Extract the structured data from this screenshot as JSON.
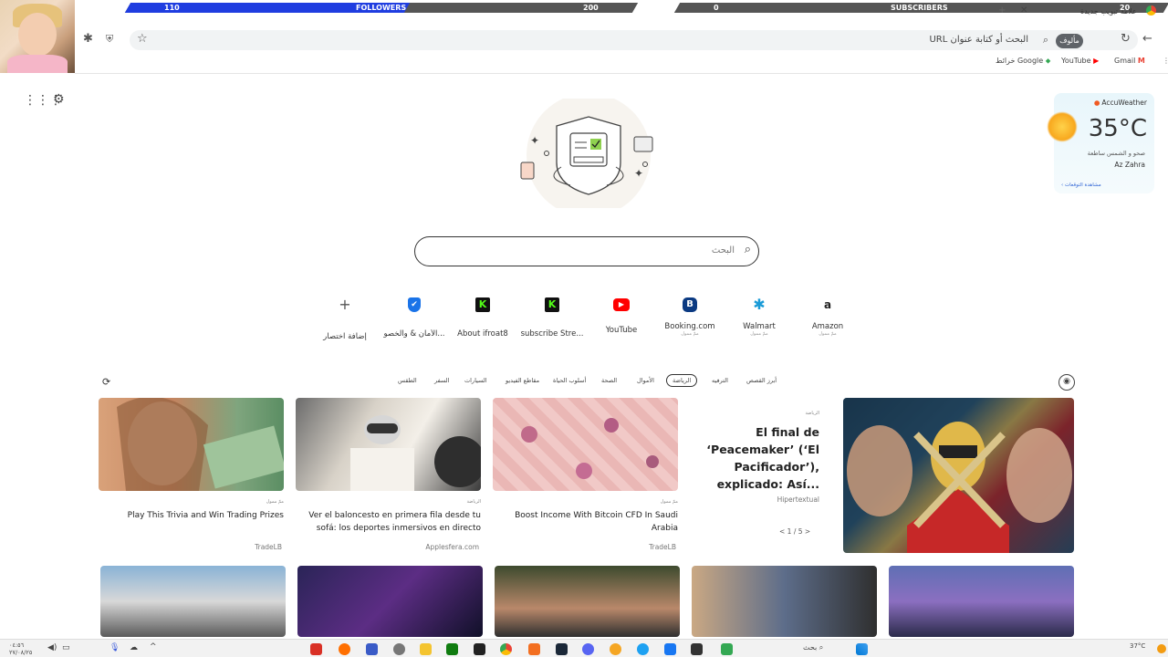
{
  "stream_overlay": {
    "followers_label": "FOLLOWERS",
    "followers_current": "110",
    "followers_goal": "200",
    "followers_progress": 0.55,
    "subscribers_label": "SUBSCRIBERS",
    "subscribers_current": "0",
    "subscribers_goal": "20"
  },
  "browser": {
    "tab_title": "علامة تبويب جديدة",
    "omnibox_placeholder": "البحث أو كتابة عنوان URL",
    "profile_label": "مألوف",
    "bookmarks": [
      {
        "label": "Gmail",
        "icon": "gmail-icon"
      },
      {
        "label": "YouTube",
        "icon": "youtube-icon"
      },
      {
        "label": "خرائط Google",
        "icon": "maps-icon"
      }
    ]
  },
  "newtab": {
    "search_placeholder": "البحث",
    "shortcuts": [
      {
        "label": "Amazon",
        "sub": "ممّ ممول",
        "letter": "a",
        "color": "#ffffff",
        "fg": "#222"
      },
      {
        "label": "Walmart",
        "sub": "ممّ ممول",
        "letter": "✱",
        "color": "#ffffff",
        "fg": "#1a9bd7"
      },
      {
        "label": "Booking.com",
        "sub": "ممّ ممول",
        "letter": "B",
        "color": "#0b3a82",
        "fg": "#ffffff"
      },
      {
        "label": "YouTube",
        "sub": "",
        "letter": "▶",
        "color": "#ff0000",
        "fg": "#ffffff"
      },
      {
        "label": "subscribe Stre...",
        "sub": "",
        "letter": "K",
        "color": "#111111",
        "fg": "#53fc18"
      },
      {
        "label": "About ifroat8",
        "sub": "",
        "letter": "K",
        "color": "#111111",
        "fg": "#53fc18"
      },
      {
        "label": "الأمان & والخصو...",
        "sub": "",
        "letter": "✔",
        "color": "#1a73e8",
        "fg": "#ffffff"
      },
      {
        "label": "إضافة اختصار",
        "sub": "",
        "letter": "+",
        "color": "#ffffff",
        "fg": "#555"
      }
    ],
    "weather": {
      "brand": "AccuWeather",
      "temp": "35°C",
      "condition": "صحو و الشمس ساطعة",
      "place": "Az Zahra",
      "link": "مشاهدة التوقعات"
    }
  },
  "feed": {
    "categories": [
      "أبرز القصص",
      "الترفيه",
      "الرياضة",
      "الأموال",
      "الصحة",
      "أسلوب الحياة",
      "مقاطع الفيديو",
      "السيارات",
      "السفر",
      "الطقس"
    ],
    "active_category": "الرياضة",
    "hero": {
      "category": "الرياضة",
      "title": "El final de ‘Peacemaker’ (‘El Pacificador’), explicado: Así...",
      "source": "Hipertextual",
      "pager": "< 1 / 5 >"
    },
    "cards": [
      {
        "meta": "ممّ ممول",
        "title": "Boost Income With Bitcoin CFD In Saudi Arabia",
        "source": "TradeLB"
      },
      {
        "meta": "الرياضة",
        "title": "Ver el baloncesto en primera fila desde tu sofá: los deportes inmersivos en directo",
        "source": "Applesfera.com"
      },
      {
        "meta": "ممّ ممول",
        "title": "Play This Trivia and Win Trading Prizes",
        "source": "TradeLB"
      }
    ]
  },
  "taskbar": {
    "search_label": "بحث",
    "weather": "37°C",
    "clock_time": "٠٤:٥٦",
    "clock_date": "٢٧/٠٨/٢٥"
  }
}
